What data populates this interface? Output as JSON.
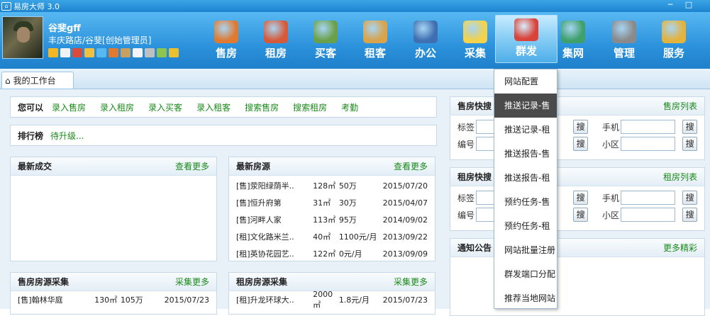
{
  "window": {
    "title": "易房大师 3.0",
    "controls": [
      "─",
      "□"
    ]
  },
  "user": {
    "name": "谷斐gff",
    "info": "丰庆路店/谷斐[创始管理员]"
  },
  "quick_icons": [
    "#f4b623",
    "#f2f2f2",
    "#d94b3b",
    "#f0c040",
    "#5ab8f0",
    "#e07a30",
    "#c8a060",
    "#f5f5f5",
    "#c0c0c0",
    "#8ec550",
    "#e8c030"
  ],
  "nav": [
    {
      "label": "售房",
      "color": "#e07a30",
      "active": false
    },
    {
      "label": "租房",
      "color": "#d65a3a",
      "active": false
    },
    {
      "label": "买客",
      "color": "#6aa04a",
      "active": false
    },
    {
      "label": "租客",
      "color": "#d9a34a",
      "active": false
    },
    {
      "label": "办公",
      "color": "#3f6fb0",
      "active": false
    },
    {
      "label": "采集",
      "color": "#f4d34a",
      "active": false
    },
    {
      "label": "群发",
      "color": "#d9433a",
      "active": true
    },
    {
      "label": "集网",
      "color": "#3fa06a",
      "active": false
    },
    {
      "label": "管理",
      "color": "#8a8a8a",
      "active": false
    },
    {
      "label": "服务",
      "color": "#e5b23a",
      "active": false
    }
  ],
  "tab": {
    "label": "我的工作台"
  },
  "can_do": {
    "title": "您可以",
    "links": [
      "录入售房",
      "录入租房",
      "录入买客",
      "录入租客",
      "搜索售房",
      "搜索租房",
      "考勤"
    ]
  },
  "ranking": {
    "title": "排行榜",
    "value": "待升级..."
  },
  "latest_deals": {
    "title": "最新成交",
    "more": "查看更多"
  },
  "latest_listings": {
    "title": "最新房源",
    "more": "查看更多",
    "rows": [
      {
        "name": "[售]荥阳绿荫半..",
        "area": "128㎡",
        "price": "50万",
        "date": "2015/07/20"
      },
      {
        "name": "[售]恒升府第",
        "area": "31㎡",
        "price": "30万",
        "date": "2015/04/07"
      },
      {
        "name": "[售]河畔人家",
        "area": "113㎡",
        "price": "95万",
        "date": "2014/09/02"
      },
      {
        "name": "[租]文化路米兰..",
        "area": "40㎡",
        "price": "1100元/月",
        "date": "2013/09/22"
      },
      {
        "name": "[租]英协花园艺..",
        "area": "122㎡",
        "price": "0元/月",
        "date": "2013/09/09"
      }
    ]
  },
  "sale_collect": {
    "title": "售房房源采集",
    "more": "采集更多",
    "rows": [
      {
        "name": "[售]翰林华庭",
        "area": "130㎡",
        "price": "105万",
        "date": "2015/07/23"
      }
    ]
  },
  "rent_collect": {
    "title": "租房房源采集",
    "more": "采集更多",
    "rows": [
      {
        "name": "[租]升龙环球大..",
        "area": "2000㎡",
        "price": "1.8元/月",
        "date": "2015/07/23"
      }
    ]
  },
  "sale_search": {
    "title": "售房快搜",
    "more": "售房列表",
    "label1": "标签",
    "label2": "手机",
    "label3": "编号",
    "label4": "小区",
    "btn": "搜"
  },
  "rent_search": {
    "title": "租房快搜",
    "more": "租房列表",
    "label1": "标签",
    "label2": "手机",
    "label3": "编号",
    "label4": "小区",
    "btn": "搜"
  },
  "notice": {
    "title": "通知公告",
    "more": "更多精彩"
  },
  "dropdown": {
    "items": [
      "网站配置",
      "推送记录-售",
      "推送记录-租",
      "推送报告-售",
      "推送报告-租",
      "预约任务-售",
      "预约任务-租",
      "网站批量注册",
      "群发端口分配",
      "推荐当地网站"
    ],
    "highlighted": 1
  }
}
